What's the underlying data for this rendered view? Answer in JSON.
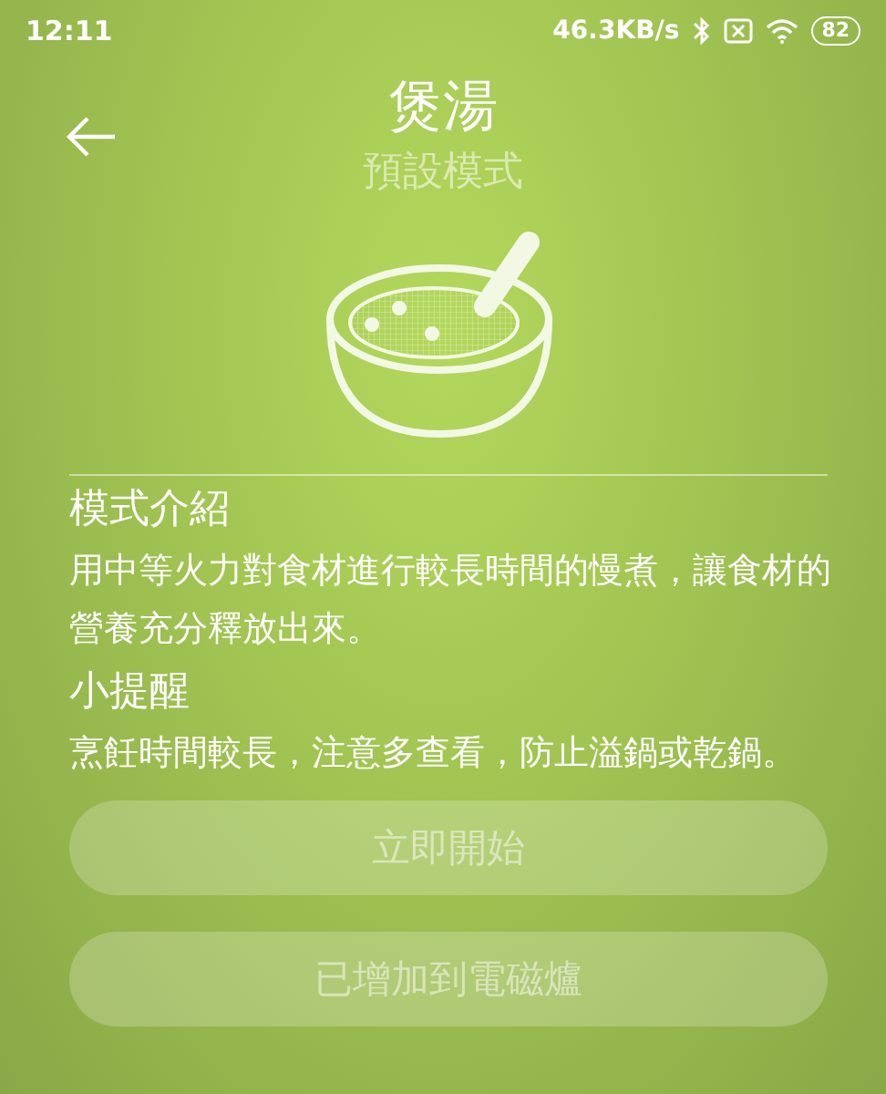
{
  "status_bar": {
    "time": "12:11",
    "speed": "46.3KB/s",
    "battery": "82"
  },
  "header": {
    "title": "煲湯",
    "subtitle": "預設模式"
  },
  "sections": [
    {
      "heading": "模式介紹",
      "body": "用中等火力對食材進行較長時間的慢煮，讓食材的營養充分釋放出來。"
    },
    {
      "heading": "小提醒",
      "body": "烹飪時間較長，注意多查看，防止溢鍋或乾鍋。"
    }
  ],
  "buttons": [
    {
      "label": "立即開始",
      "disabled": true
    },
    {
      "label": "已增加到電磁爐",
      "disabled": true
    }
  ]
}
